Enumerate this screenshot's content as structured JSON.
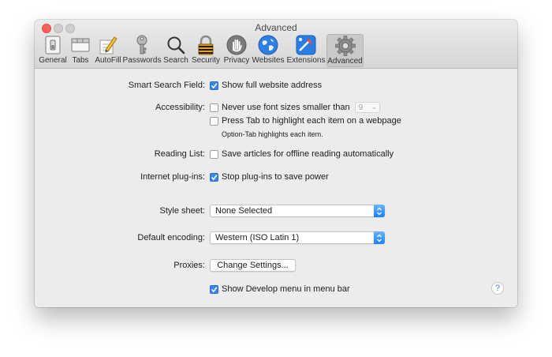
{
  "window": {
    "title": "Advanced"
  },
  "toolbar": {
    "items": [
      {
        "label": "General",
        "icon": "general-switch-icon"
      },
      {
        "label": "Tabs",
        "icon": "tabs-icon"
      },
      {
        "label": "AutoFill",
        "icon": "pencil-form-icon"
      },
      {
        "label": "Passwords",
        "icon": "key-icon"
      },
      {
        "label": "Search",
        "icon": "magnifier-icon"
      },
      {
        "label": "Security",
        "icon": "padlock-icon"
      },
      {
        "label": "Privacy",
        "icon": "hand-icon"
      },
      {
        "label": "Websites",
        "icon": "globe-icon"
      },
      {
        "label": "Extensions",
        "icon": "puzzle-icon"
      },
      {
        "label": "Advanced",
        "icon": "gear-icon"
      }
    ],
    "active": "Advanced"
  },
  "settings": {
    "smart_search": {
      "label": "Smart Search Field:",
      "option": "Show full website address",
      "checked": true
    },
    "accessibility": {
      "label": "Accessibility:",
      "font_option": "Never use font sizes smaller than",
      "font_size": "9",
      "tab_option": "Press Tab to highlight each item on a webpage",
      "tab_note": "Option-Tab highlights each item."
    },
    "reading_list": {
      "label": "Reading List:",
      "option": "Save articles for offline reading automatically",
      "checked": false
    },
    "plugins": {
      "label": "Internet plug-ins:",
      "option": "Stop plug-ins to save power",
      "checked": true
    },
    "style_sheet": {
      "label": "Style sheet:",
      "value": "None Selected"
    },
    "encoding": {
      "label": "Default encoding:",
      "value": "Western (ISO Latin 1)"
    },
    "proxies": {
      "label": "Proxies:",
      "button": "Change Settings..."
    },
    "develop": {
      "option": "Show Develop menu in menu bar",
      "checked": true
    }
  },
  "help": {
    "glyph": "?"
  },
  "colors": {
    "accent": "#3a85e8",
    "close": "#fc605c"
  }
}
